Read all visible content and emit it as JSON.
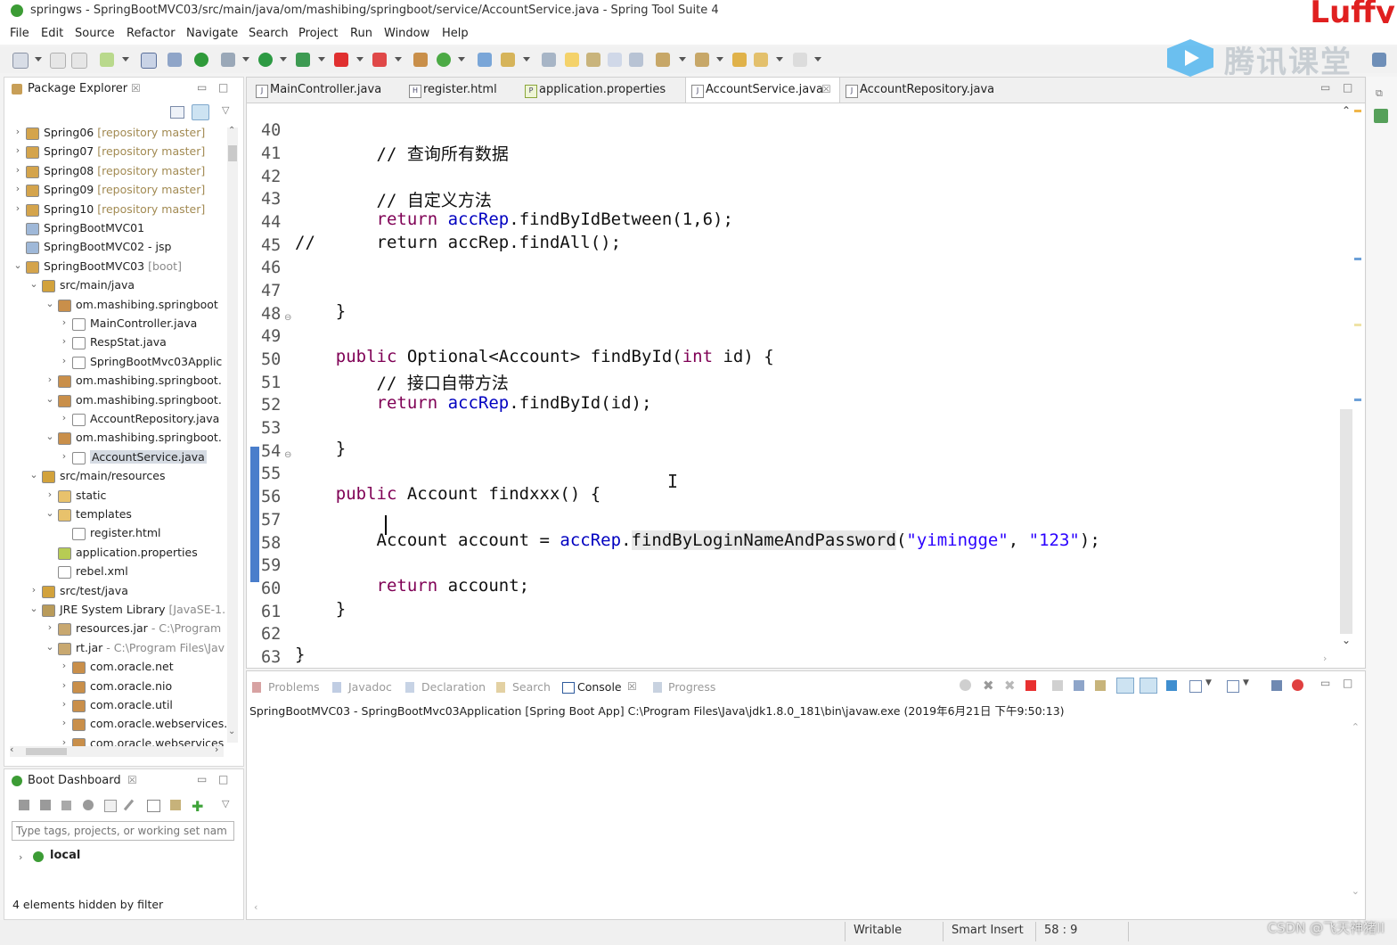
{
  "window": {
    "title": "springws - SpringBootMVC03/src/main/java/om/mashibing/springboot/service/AccountService.java - Spring Tool Suite 4",
    "overlay_brand": "Luffy",
    "watermark_text": "腾讯课堂"
  },
  "menu": [
    "File",
    "Edit",
    "Source",
    "Refactor",
    "Navigate",
    "Search",
    "Project",
    "Run",
    "Window",
    "Help"
  ],
  "package_explorer": {
    "title": "Package Explorer",
    "items": [
      {
        "label": "Spring06",
        "decoration": "[repository master]"
      },
      {
        "label": "Spring07",
        "decoration": "[repository master]"
      },
      {
        "label": "Spring08",
        "decoration": "[repository master]"
      },
      {
        "label": "Spring09",
        "decoration": "[repository master]"
      },
      {
        "label": "Spring10",
        "decoration": "[repository master]"
      },
      {
        "label": "SpringBootMVC01",
        "decoration": ""
      },
      {
        "label": "SpringBootMVC02 - jsp",
        "decoration": ""
      },
      {
        "label": "SpringBootMVC03",
        "decoration": "[boot]"
      },
      {
        "label": "src/main/java",
        "decoration": ""
      },
      {
        "label": "om.mashibing.springboot",
        "decoration": ""
      },
      {
        "label": "MainController.java",
        "decoration": ""
      },
      {
        "label": "RespStat.java",
        "decoration": ""
      },
      {
        "label": "SpringBootMvc03Applic",
        "decoration": ""
      },
      {
        "label": "om.mashibing.springboot.",
        "decoration": ""
      },
      {
        "label": "om.mashibing.springboot.",
        "decoration": ""
      },
      {
        "label": "AccountRepository.java",
        "decoration": ""
      },
      {
        "label": "om.mashibing.springboot.",
        "decoration": ""
      },
      {
        "label": "AccountService.java",
        "decoration": ""
      },
      {
        "label": "src/main/resources",
        "decoration": ""
      },
      {
        "label": "static",
        "decoration": ""
      },
      {
        "label": "templates",
        "decoration": ""
      },
      {
        "label": "register.html",
        "decoration": ""
      },
      {
        "label": "application.properties",
        "decoration": ""
      },
      {
        "label": "rebel.xml",
        "decoration": ""
      },
      {
        "label": "src/test/java",
        "decoration": ""
      },
      {
        "label": "JRE System Library",
        "decoration": "[JavaSE-1."
      },
      {
        "label": "resources.jar",
        "decoration": "- C:\\Program"
      },
      {
        "label": "rt.jar",
        "decoration": "- C:\\Program Files\\Jav"
      },
      {
        "label": "com.oracle.net",
        "decoration": ""
      },
      {
        "label": "com.oracle.nio",
        "decoration": ""
      },
      {
        "label": "com.oracle.util",
        "decoration": ""
      },
      {
        "label": "com.oracle.webservices.",
        "decoration": ""
      },
      {
        "label": "com.oracle.webservices",
        "decoration": ""
      }
    ]
  },
  "boot_dashboard": {
    "title": "Boot Dashboard",
    "filter_placeholder": "Type tags, projects, or working set nam",
    "local_label": "local",
    "hidden_note": "4 elements hidden by filter"
  },
  "editor": {
    "tabs": [
      {
        "label": "MainController.java",
        "icon": "J"
      },
      {
        "label": "register.html",
        "icon": "H"
      },
      {
        "label": "application.properties",
        "icon": "P"
      },
      {
        "label": "AccountService.java",
        "icon": "J",
        "active": true
      },
      {
        "label": "AccountRepository.java",
        "icon": "J"
      }
    ],
    "lines": [
      {
        "n": "40",
        "text": "        // 查询所有数据"
      },
      {
        "n": "41",
        "text": ""
      },
      {
        "n": "42",
        "text": "        // 自定义方法"
      },
      {
        "n": "43",
        "text": "        return accRep.findByIdBetween(1,6);"
      },
      {
        "n": "44",
        "text": "//      return accRep.findAll();"
      },
      {
        "n": "45",
        "text": ""
      },
      {
        "n": "46",
        "text": ""
      },
      {
        "n": "47",
        "text": "    }"
      },
      {
        "n": "48",
        "text": ""
      },
      {
        "n": "49",
        "text": "    public Optional<Account> findById(int id) {"
      },
      {
        "n": "50",
        "text": "        // 接口自带方法"
      },
      {
        "n": "51",
        "text": "        return accRep.findById(id);"
      },
      {
        "n": "52",
        "text": ""
      },
      {
        "n": "53",
        "text": "    }"
      },
      {
        "n": "54",
        "text": ""
      },
      {
        "n": "55",
        "text": "    public Account findxxx() {"
      },
      {
        "n": "56",
        "text": ""
      },
      {
        "n": "57",
        "text": "        Account account = accRep.findByLoginNameAndPassword(\"yimingge\", \"123\");"
      },
      {
        "n": "58",
        "text": ""
      },
      {
        "n": "59",
        "text": "        return account;"
      },
      {
        "n": "60",
        "text": "    }"
      },
      {
        "n": "61",
        "text": ""
      },
      {
        "n": "62",
        "text": "}"
      },
      {
        "n": "63",
        "text": ""
      }
    ]
  },
  "console": {
    "tabs": [
      "Problems",
      "Javadoc",
      "Declaration",
      "Search",
      "Console",
      "Progress"
    ],
    "active_tab": "Console",
    "launch_line": "SpringBootMVC03 - SpringBootMvc03Application [Spring Boot App] C:\\Program Files\\Java\\jdk1.8.0_181\\bin\\javaw.exe (2019年6月21日 下午9:50:13)"
  },
  "status_bar": {
    "writable": "Writable",
    "insert_mode": "Smart Insert",
    "position": "58 : 9"
  },
  "footer_watermark": "CSDN @飞天神猪II"
}
